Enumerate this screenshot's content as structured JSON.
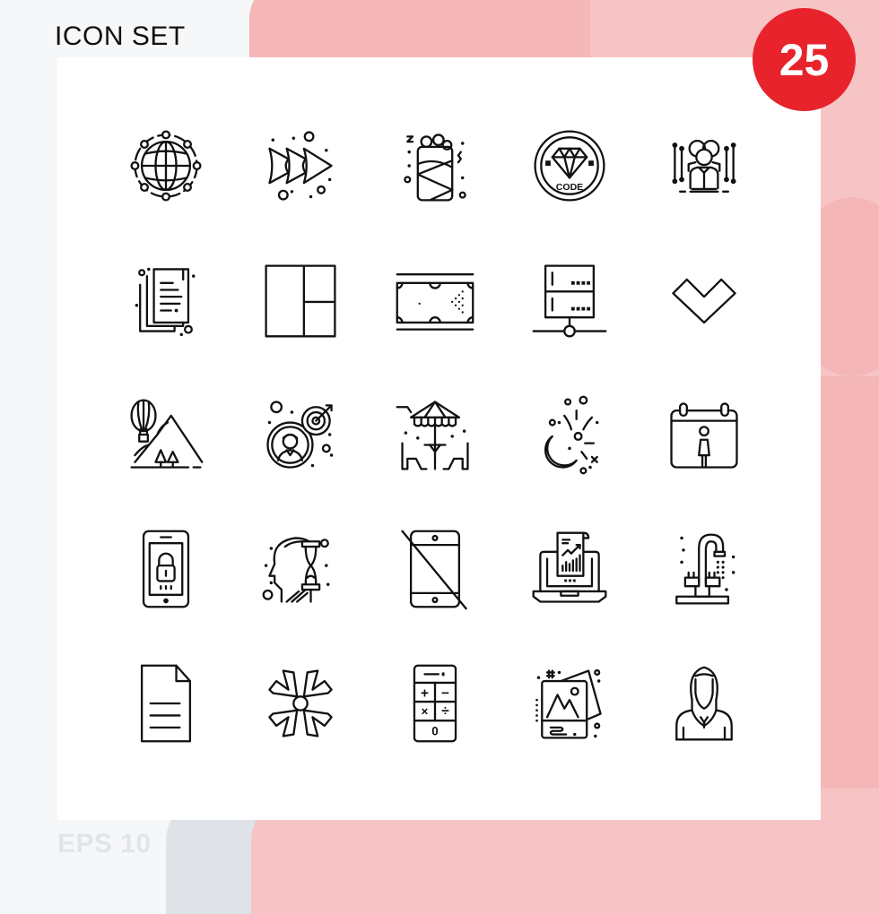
{
  "header": {
    "title": "ICON SET",
    "badge_count": "25"
  },
  "footer": {
    "format_label": "EPS 10"
  },
  "colors": {
    "badge": "#e8232b",
    "pink_light": "#f7c4c5",
    "pink_mid": "#f6b7b8",
    "gray_shape": "#dfe3e7",
    "background": "#f6f7f9",
    "panel": "#ffffff",
    "icon_stroke": "#111111"
  },
  "icons": [
    {
      "name": "global-network-icon",
      "label": "global network"
    },
    {
      "name": "forward-arrows-icon",
      "label": "forward arrows"
    },
    {
      "name": "burrito-icon",
      "label": "burrito"
    },
    {
      "name": "diamond-code-icon",
      "label": "diamond code",
      "text": "CODE"
    },
    {
      "name": "team-network-icon",
      "label": "team network"
    },
    {
      "name": "documents-icon",
      "label": "documents"
    },
    {
      "name": "layout-grid-icon",
      "label": "layout grid"
    },
    {
      "name": "billiard-table-icon",
      "label": "billiard table"
    },
    {
      "name": "server-network-icon",
      "label": "server network"
    },
    {
      "name": "chevron-down-icon",
      "label": "chevron down"
    },
    {
      "name": "hot-air-balloon-mountain-icon",
      "label": "hot air balloon mountain"
    },
    {
      "name": "user-target-icon",
      "label": "user target"
    },
    {
      "name": "outdoor-cafe-icon",
      "label": "outdoor cafe"
    },
    {
      "name": "moon-fireworks-icon",
      "label": "moon fireworks"
    },
    {
      "name": "calendar-person-icon",
      "label": "calendar person"
    },
    {
      "name": "mobile-lock-icon",
      "label": "mobile lock"
    },
    {
      "name": "head-hourglass-icon",
      "label": "head hourglass"
    },
    {
      "name": "no-mobile-icon",
      "label": "no mobile"
    },
    {
      "name": "laptop-report-icon",
      "label": "laptop report"
    },
    {
      "name": "water-tap-icon",
      "label": "water tap"
    },
    {
      "name": "document-file-icon",
      "label": "document file"
    },
    {
      "name": "collapse-arrows-icon",
      "label": "collapse arrows"
    },
    {
      "name": "calculator-icon",
      "label": "calculator",
      "keys": [
        "+",
        "−",
        "×",
        "÷",
        "0"
      ]
    },
    {
      "name": "photos-icon",
      "label": "photos"
    },
    {
      "name": "woman-avatar-icon",
      "label": "woman avatar"
    }
  ]
}
